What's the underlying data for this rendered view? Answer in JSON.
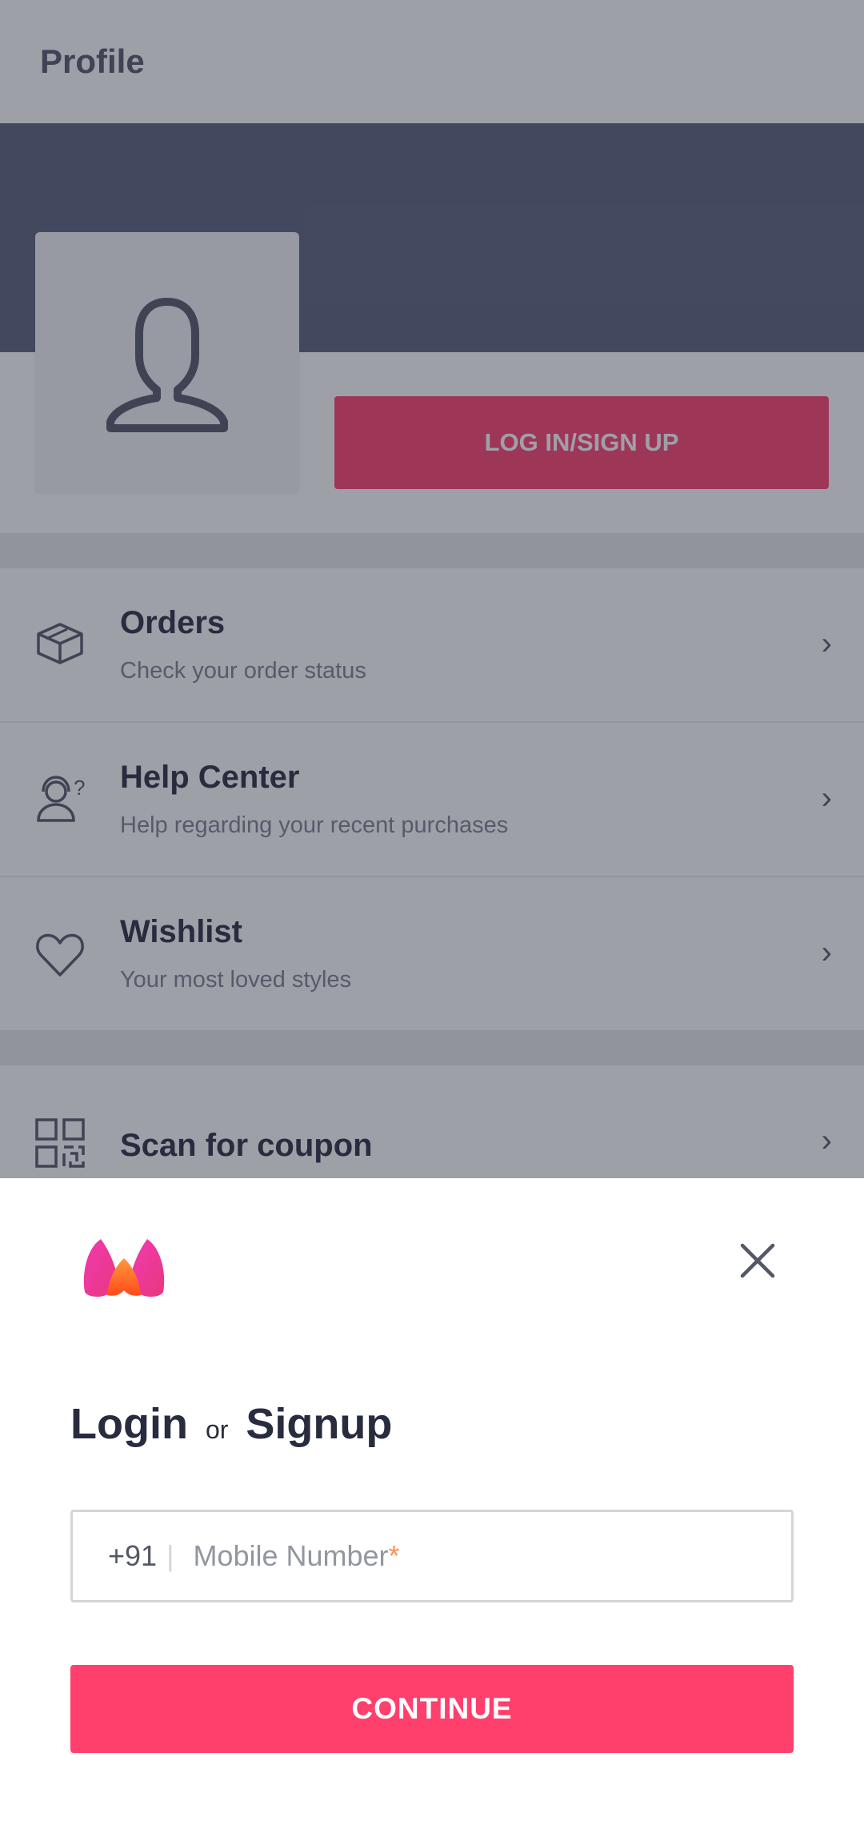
{
  "profile": {
    "title": "Profile",
    "login_button": "LOG IN/SIGN UP",
    "menu": [
      {
        "label": "Orders",
        "sub": "Check your order status",
        "icon": "box-icon"
      },
      {
        "label": "Help Center",
        "sub": "Help regarding your recent purchases",
        "icon": "support-agent-icon"
      },
      {
        "label": "Wishlist",
        "sub": "Your most loved styles",
        "icon": "heart-icon"
      },
      {
        "label": "Scan for coupon",
        "sub": "",
        "icon": "qr-code-icon"
      }
    ]
  },
  "sheet": {
    "logo_icon": "myntra-logo",
    "close_icon": "close-icon",
    "heading_login": "Login",
    "heading_or": "or",
    "heading_signup": "Signup",
    "country_code": "+91",
    "separator": "|",
    "phone_placeholder": "Mobile Number",
    "required_marker": "*",
    "continue_button": "CONTINUE"
  },
  "colors": {
    "accent": "#ff3f6c",
    "banner": "#5a607a",
    "overlay": "rgba(40,44,63,0.45)"
  }
}
